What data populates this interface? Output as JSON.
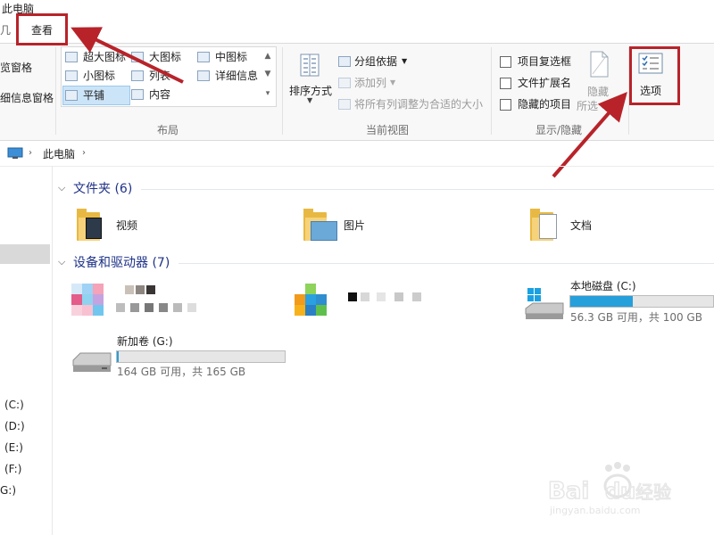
{
  "window": {
    "title": "此电脑",
    "title_partial_glyph": "几"
  },
  "tabs": {
    "view": "查看"
  },
  "ribbon": {
    "left_cut": {
      "preview_pane": "览窗格",
      "details_pane": "细信息窗格"
    },
    "layout": {
      "items": [
        "超大图标",
        "大图标",
        "中图标",
        "小图标",
        "列表",
        "详细信息",
        "平铺",
        "内容"
      ],
      "selected": "平铺",
      "group_label": "布局"
    },
    "current_view": {
      "sort_by": "排序方式",
      "group_by": "分组依据",
      "add_columns": "添加列",
      "fit_columns": "将所有列调整为合适的大小",
      "group_label": "当前视图"
    },
    "show_hide": {
      "item_checkboxes": "项目复选框",
      "file_extensions": "文件扩展名",
      "hidden_items": "隐藏的项目",
      "hide_selected_top": "隐藏",
      "hide_selected_bottom": "所选",
      "group_label": "显示/隐藏"
    },
    "options": {
      "label": "选项"
    }
  },
  "address": {
    "path_item": "此电脑"
  },
  "nav": {
    "drives": [
      "(C:)",
      "(D:)",
      "(E:)",
      "(F:)",
      "G:)"
    ]
  },
  "content": {
    "folders_header": "文件夹 (6)",
    "folders": [
      "视频",
      "图片",
      "文档"
    ],
    "devices_header": "设备和驱动器 (7)",
    "local_disk": {
      "name": "本地磁盘 (C:)",
      "space": "56.3 GB 可用，共 100 GB",
      "used_fraction": 0.437
    },
    "new_volume": {
      "name": "新加卷 (G:)",
      "space": "164 GB 可用，共 165 GB",
      "used_fraction": 0.006
    }
  },
  "watermark": {
    "logo": "Bai du 经验",
    "url": "jingyan.baidu.com"
  },
  "colors": {
    "annotation_red": "#b8232a",
    "accent_blue": "#26a0da",
    "header_blue": "#1e3287",
    "selected_bg": "#cce4f7"
  }
}
